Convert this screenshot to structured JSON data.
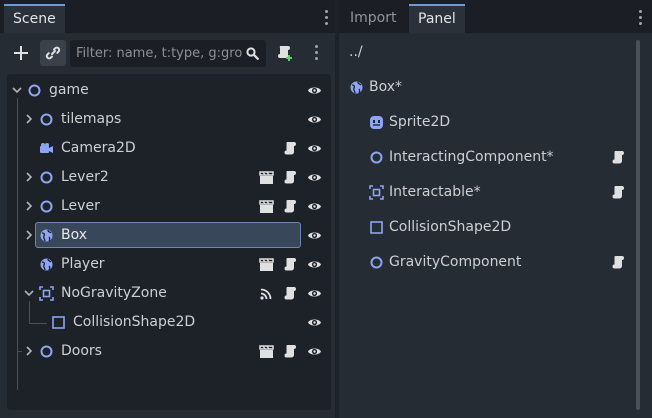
{
  "scene_dock": {
    "tab_label": "Scene",
    "filter_placeholder": "Filter: name, t:type, g:gro",
    "tree": [
      {
        "label": "game",
        "icon": "node-circle-icon",
        "expand": "open",
        "depth": 0,
        "badges": []
      },
      {
        "label": "tilemaps",
        "icon": "node-circle-icon",
        "expand": "closed",
        "depth": 1,
        "badges": []
      },
      {
        "label": "Camera2D",
        "icon": "camera-icon",
        "expand": "none",
        "depth": 1,
        "badges": [
          "script"
        ]
      },
      {
        "label": "Lever2",
        "icon": "node-circle-icon",
        "expand": "closed",
        "depth": 1,
        "badges": [
          "clapper",
          "script"
        ]
      },
      {
        "label": "Lever",
        "icon": "node-circle-icon",
        "expand": "closed",
        "depth": 1,
        "badges": [
          "clapper",
          "script"
        ]
      },
      {
        "label": "Box",
        "icon": "globe-icon",
        "expand": "closed",
        "depth": 1,
        "badges": [],
        "selected": true
      },
      {
        "label": "Player",
        "icon": "globe-icon",
        "expand": "none",
        "depth": 1,
        "badges": [
          "clapper",
          "script"
        ]
      },
      {
        "label": "NoGravityZone",
        "icon": "area-icon",
        "expand": "open",
        "depth": 1,
        "badges": [
          "signal",
          "script"
        ]
      },
      {
        "label": "CollisionShape2D",
        "icon": "square-icon",
        "expand": "none",
        "depth": 2,
        "badges": []
      },
      {
        "label": "Doors",
        "icon": "node-circle-icon",
        "expand": "closed",
        "depth": 1,
        "badges": [
          "clapper",
          "script"
        ]
      }
    ]
  },
  "right_dock": {
    "tabs": [
      {
        "label": "Import",
        "active": false
      },
      {
        "label": "Panel",
        "active": true
      }
    ],
    "parent_path": "../",
    "items": [
      {
        "label": "Box*",
        "icon": "globe-icon",
        "indent": 0,
        "script": false
      },
      {
        "label": "Sprite2D",
        "icon": "sprite-icon",
        "indent": 1,
        "script": false
      },
      {
        "label": "InteractingComponent*",
        "icon": "node-circle-icon",
        "indent": 1,
        "script": true
      },
      {
        "label": "Interactable*",
        "icon": "area-icon",
        "indent": 1,
        "script": true
      },
      {
        "label": "CollisionShape2D",
        "icon": "square-icon",
        "indent": 1,
        "script": false
      },
      {
        "label": "GravityComponent",
        "icon": "node-circle-icon",
        "indent": 1,
        "script": true
      }
    ]
  },
  "colors": {
    "node_icon": "#8da5f3",
    "badge": "#e0e0e0",
    "selection": "#39475a",
    "accent": "#6b9bd8"
  }
}
